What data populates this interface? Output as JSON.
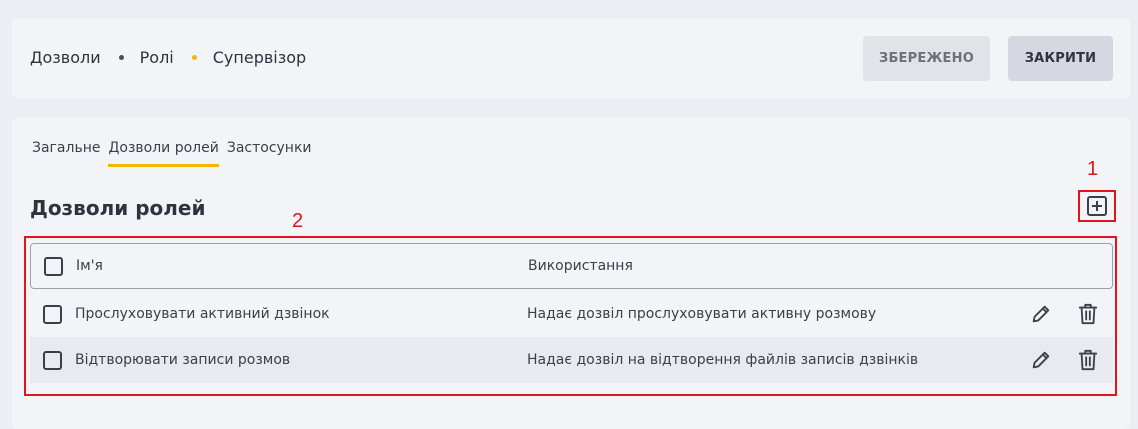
{
  "breadcrumb": {
    "items": [
      "Дозволи",
      "Ролі",
      "Супервізор"
    ]
  },
  "header": {
    "saved_label": "ЗБЕРЕЖЕНО",
    "close_label": "ЗАКРИТИ"
  },
  "tabs": [
    {
      "label": "Загальне",
      "active": false
    },
    {
      "label": "Дозволи ролей",
      "active": true
    },
    {
      "label": "Застосунки",
      "active": false
    }
  ],
  "section": {
    "title": "Дозволи ролей",
    "add_icon": "plus-square-icon"
  },
  "annotations": {
    "marker_1": "1",
    "marker_2": "2",
    "color": "#e0141c"
  },
  "table": {
    "columns": [
      "Ім'я",
      "Використання"
    ],
    "rows": [
      {
        "name": "Прослуховувати активний дзвінок",
        "usage": "Надає дозвіл прослуховувати активну розмову",
        "checked": false
      },
      {
        "name": "Відтворювати записи розмов",
        "usage": "Надає дозвіл на відтворення файлів записів дзвінків",
        "checked": false
      }
    ],
    "row_actions": [
      "edit-icon",
      "trash-icon"
    ]
  },
  "colors": {
    "accent": "#f5b400",
    "background": "#eceef3",
    "card": "#f3f4f8"
  }
}
